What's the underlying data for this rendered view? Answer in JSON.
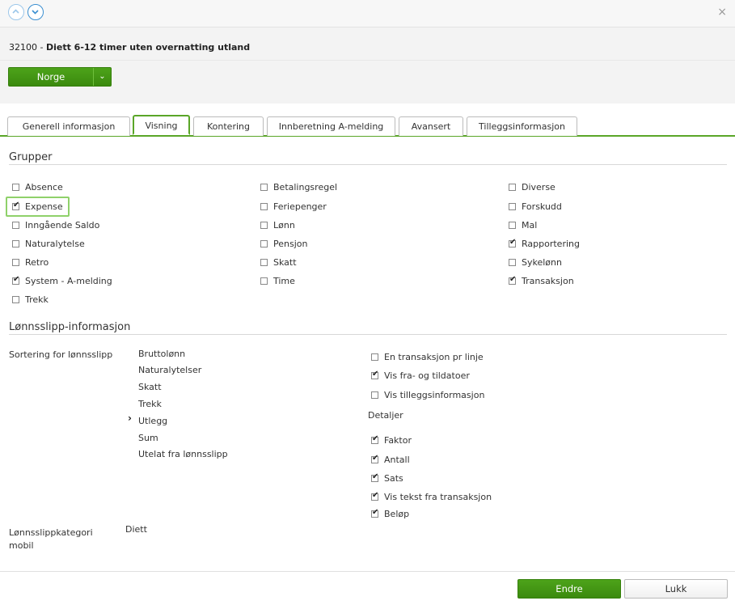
{
  "header": {
    "code": "32100",
    "separator": " - ",
    "name": "Diett 6-12 timer uten overnatting utland",
    "country_button": "Norge"
  },
  "tabs": [
    {
      "label": "Generell informasjon"
    },
    {
      "label": "Visning"
    },
    {
      "label": "Kontering"
    },
    {
      "label": "Innberetning A-melding"
    },
    {
      "label": "Avansert"
    },
    {
      "label": "Tilleggsinformasjon"
    }
  ],
  "active_tab": "Visning",
  "groups": {
    "title": "Grupper",
    "items": [
      {
        "label": "Absence",
        "checked": false
      },
      {
        "label": "Expense",
        "checked": true
      },
      {
        "label": "Inngående Saldo",
        "checked": false
      },
      {
        "label": "Naturalytelse",
        "checked": false
      },
      {
        "label": "Retro",
        "checked": false
      },
      {
        "label": "System - A-melding",
        "checked": true
      },
      {
        "label": "Trekk",
        "checked": false
      },
      {
        "label": "Betalingsregel",
        "checked": false
      },
      {
        "label": "Feriepenger",
        "checked": false
      },
      {
        "label": "Lønn",
        "checked": false
      },
      {
        "label": "Pensjon",
        "checked": false
      },
      {
        "label": "Skatt",
        "checked": false
      },
      {
        "label": "Time",
        "checked": false
      },
      {
        "label": "Diverse",
        "checked": false
      },
      {
        "label": "Forskudd",
        "checked": false
      },
      {
        "label": "Mal",
        "checked": false
      },
      {
        "label": "Rapportering",
        "checked": true
      },
      {
        "label": "Sykelønn",
        "checked": false
      },
      {
        "label": "Transaksjon",
        "checked": true
      }
    ]
  },
  "payslip": {
    "title": "Lønnsslipp-informasjon",
    "sort_label": "Sortering for lønnsslipp",
    "sort_items": [
      "Bruttolønn",
      "Naturalytelser",
      "Skatt",
      "Trekk",
      "Utlegg",
      "Sum",
      "Utelat fra lønnsslipp"
    ],
    "selected_sort": "Utlegg",
    "options": [
      {
        "label": "En transaksjon pr linje",
        "checked": false
      },
      {
        "label": "Vis fra- og tildatoer",
        "checked": true
      },
      {
        "label": "Vis tilleggsinformasjon",
        "checked": false
      }
    ],
    "details_label": "Detaljer",
    "details": [
      {
        "label": "Faktor",
        "checked": true
      },
      {
        "label": "Antall",
        "checked": true
      },
      {
        "label": "Sats",
        "checked": true
      },
      {
        "label": "Vis tekst fra transaksjon",
        "checked": true
      },
      {
        "label": "Beløp",
        "checked": true
      }
    ],
    "category_label_line1": "Lønnsslippkategori",
    "category_label_line2": "mobil",
    "category_value": "Diett"
  },
  "footer": {
    "primary": "Endre",
    "secondary": "Lukk"
  },
  "icons": {
    "up": "chevron-up-icon",
    "down": "chevron-down-icon",
    "close": "close-icon",
    "arrow": "chevron-right-icon"
  },
  "colors": {
    "accent_green": "#4da31a",
    "nav_blue": "#3b8fd1",
    "highlight": "#8fd16a"
  }
}
